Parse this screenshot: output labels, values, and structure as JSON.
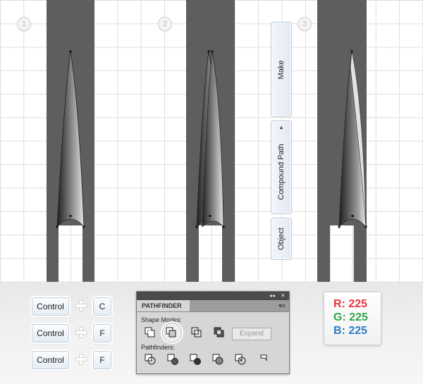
{
  "steps": [
    "1",
    "2",
    "3"
  ],
  "context_menu": {
    "items": [
      {
        "label": "Make"
      },
      {
        "label": "Compound Path",
        "submenu_arrow": "▲"
      },
      {
        "label": "Object"
      }
    ]
  },
  "shortcuts": [
    {
      "modifier": "Control",
      "key": "C"
    },
    {
      "modifier": "Control",
      "key": "F"
    },
    {
      "modifier": "Control",
      "key": "F"
    }
  ],
  "pathfinder": {
    "title": "PATHFINDER",
    "titlebar_buttons": [
      "◂◂",
      "✕"
    ],
    "menu_icon": "▾≡",
    "shape_modes_label": "Shape Modes:",
    "pathfinders_label": "Pathfinders:",
    "expand_label": "Expand",
    "shape_mode_icons": [
      "unite-icon",
      "minus-front-icon",
      "intersect-icon",
      "exclude-icon"
    ],
    "pathfinder_icons": [
      "divide-icon",
      "trim-icon",
      "merge-icon",
      "crop-icon",
      "outline-icon",
      "minus-back-icon"
    ],
    "selected_shape_mode": "minus-front-icon"
  },
  "color": {
    "r_label": "R: 225",
    "g_label": "G: 225",
    "b_label": "B: 225",
    "r_color": "#e8343d",
    "g_color": "#2ea84f",
    "b_color": "#2a7cc4"
  },
  "colors": {
    "bar": "#5e5e5e",
    "grid": "#dedede"
  }
}
